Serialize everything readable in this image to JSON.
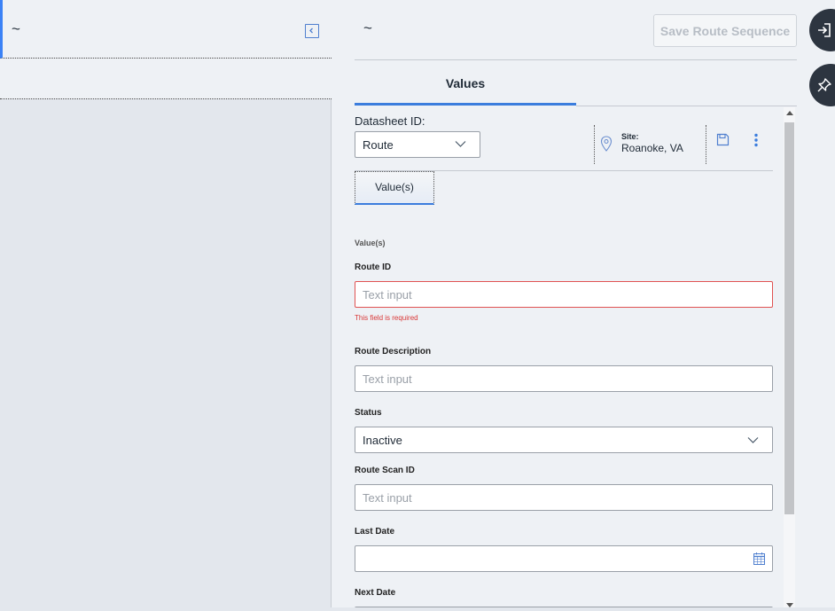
{
  "left_panel": {
    "header_symbol": "~"
  },
  "right_panel": {
    "header_symbol": "~",
    "save_route_label": "Save Route Sequence",
    "tabs": [
      {
        "label": "Values",
        "active": true
      }
    ]
  },
  "datasheet": {
    "label": "Datasheet ID:",
    "selected": "Route"
  },
  "site": {
    "label": "Site:",
    "value": "Roanoke, VA"
  },
  "subtab_label": "Value(s)",
  "form": {
    "section_title": "Value(s)",
    "route_id": {
      "label": "Route ID",
      "placeholder": "Text input",
      "error": "This field is required"
    },
    "route_description": {
      "label": "Route Description",
      "placeholder": "Text input"
    },
    "status": {
      "label": "Status",
      "value": "Inactive"
    },
    "route_scan_id": {
      "label": "Route Scan ID",
      "placeholder": "Text input"
    },
    "last_date": {
      "label": "Last Date",
      "value": ""
    },
    "next_date": {
      "label": "Next Date"
    }
  },
  "colors": {
    "accent": "#3b7ddd",
    "error": "#d93636",
    "rail": "#2d3540"
  },
  "icons": [
    "collapse-panel-icon",
    "location-pin-icon",
    "save-icon",
    "more-vertical-icon",
    "calendar-icon",
    "sign-in-icon",
    "pin-icon",
    "chevron-down-icon"
  ]
}
